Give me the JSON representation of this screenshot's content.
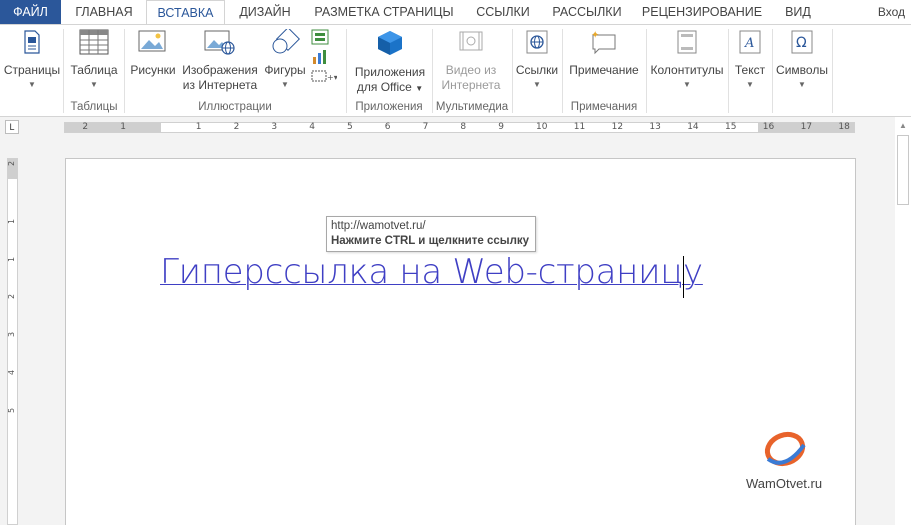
{
  "tabs": {
    "file": "ФАЙЛ",
    "home": "ГЛАВНАЯ",
    "insert": "ВСТАВКА",
    "design": "ДИЗАЙН",
    "layout": "РАЗМЕТКА СТРАНИЦЫ",
    "references": "ССЫЛКИ",
    "mailings": "РАССЫЛКИ",
    "review": "РЕЦЕНЗИРОВАНИЕ",
    "view": "ВИД"
  },
  "signin": "Вход",
  "ribbon": {
    "pages": "Страницы",
    "table": "Таблица",
    "group_tables": "Таблицы",
    "pictures": "Рисунки",
    "online_pictures_1": "Изображения",
    "online_pictures_2": "из Интернета",
    "shapes": "Фигуры",
    "group_illustrations": "Иллюстрации",
    "apps_1": "Приложения",
    "apps_2": "для Office",
    "group_apps": "Приложения",
    "video_1": "Видео из",
    "video_2": "Интернета",
    "group_media": "Мультимедиа",
    "links": "Ссылки",
    "comment": "Примечание",
    "group_comments": "Примечания",
    "header_footer": "Колонтитулы",
    "text": "Текст",
    "symbols": "Символы"
  },
  "ruler": {
    "tab_selector": "L",
    "h_numbers": [
      "2",
      "1",
      "1",
      "2",
      "3",
      "4",
      "5",
      "6",
      "7",
      "8",
      "9",
      "10",
      "11",
      "12",
      "13",
      "14",
      "15",
      "16",
      "17",
      "18"
    ],
    "v_numbers": [
      "2",
      "1",
      "1",
      "2",
      "3",
      "4",
      "5"
    ]
  },
  "document": {
    "hyperlink_text": "Гиперссылка на Web-страницу",
    "tooltip_url": "http://wamotvet.ru/",
    "tooltip_hint": "Нажмите CTRL и щелкните ссылку"
  },
  "watermark": "WamOtvet.ru",
  "colors": {
    "file_tab": "#2b579a",
    "accent": "#2b579a",
    "hyperlink": "#3f3fc4",
    "logo_orange": "#e8632b",
    "logo_blue": "#3a7bd5"
  }
}
